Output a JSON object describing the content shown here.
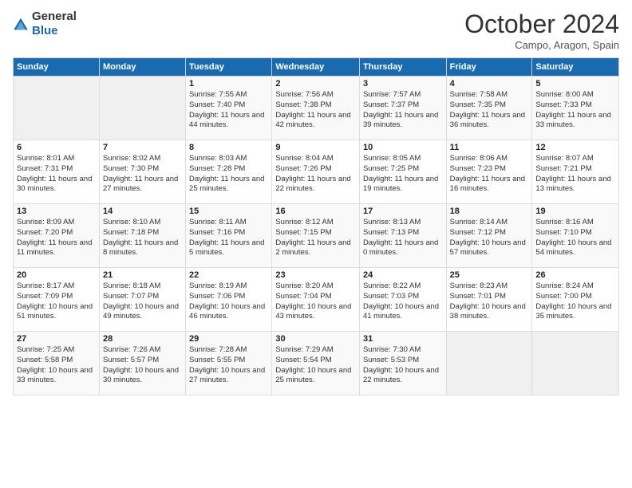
{
  "logo": {
    "general": "General",
    "blue": "Blue"
  },
  "header": {
    "month": "October 2024",
    "location": "Campo, Aragon, Spain"
  },
  "days_of_week": [
    "Sunday",
    "Monday",
    "Tuesday",
    "Wednesday",
    "Thursday",
    "Friday",
    "Saturday"
  ],
  "weeks": [
    [
      {
        "day": "",
        "info": ""
      },
      {
        "day": "",
        "info": ""
      },
      {
        "day": "1",
        "info": "Sunrise: 7:55 AM\nSunset: 7:40 PM\nDaylight: 11 hours and 44 minutes."
      },
      {
        "day": "2",
        "info": "Sunrise: 7:56 AM\nSunset: 7:38 PM\nDaylight: 11 hours and 42 minutes."
      },
      {
        "day": "3",
        "info": "Sunrise: 7:57 AM\nSunset: 7:37 PM\nDaylight: 11 hours and 39 minutes."
      },
      {
        "day": "4",
        "info": "Sunrise: 7:58 AM\nSunset: 7:35 PM\nDaylight: 11 hours and 36 minutes."
      },
      {
        "day": "5",
        "info": "Sunrise: 8:00 AM\nSunset: 7:33 PM\nDaylight: 11 hours and 33 minutes."
      }
    ],
    [
      {
        "day": "6",
        "info": "Sunrise: 8:01 AM\nSunset: 7:31 PM\nDaylight: 11 hours and 30 minutes."
      },
      {
        "day": "7",
        "info": "Sunrise: 8:02 AM\nSunset: 7:30 PM\nDaylight: 11 hours and 27 minutes."
      },
      {
        "day": "8",
        "info": "Sunrise: 8:03 AM\nSunset: 7:28 PM\nDaylight: 11 hours and 25 minutes."
      },
      {
        "day": "9",
        "info": "Sunrise: 8:04 AM\nSunset: 7:26 PM\nDaylight: 11 hours and 22 minutes."
      },
      {
        "day": "10",
        "info": "Sunrise: 8:05 AM\nSunset: 7:25 PM\nDaylight: 11 hours and 19 minutes."
      },
      {
        "day": "11",
        "info": "Sunrise: 8:06 AM\nSunset: 7:23 PM\nDaylight: 11 hours and 16 minutes."
      },
      {
        "day": "12",
        "info": "Sunrise: 8:07 AM\nSunset: 7:21 PM\nDaylight: 11 hours and 13 minutes."
      }
    ],
    [
      {
        "day": "13",
        "info": "Sunrise: 8:09 AM\nSunset: 7:20 PM\nDaylight: 11 hours and 11 minutes."
      },
      {
        "day": "14",
        "info": "Sunrise: 8:10 AM\nSunset: 7:18 PM\nDaylight: 11 hours and 8 minutes."
      },
      {
        "day": "15",
        "info": "Sunrise: 8:11 AM\nSunset: 7:16 PM\nDaylight: 11 hours and 5 minutes."
      },
      {
        "day": "16",
        "info": "Sunrise: 8:12 AM\nSunset: 7:15 PM\nDaylight: 11 hours and 2 minutes."
      },
      {
        "day": "17",
        "info": "Sunrise: 8:13 AM\nSunset: 7:13 PM\nDaylight: 11 hours and 0 minutes."
      },
      {
        "day": "18",
        "info": "Sunrise: 8:14 AM\nSunset: 7:12 PM\nDaylight: 10 hours and 57 minutes."
      },
      {
        "day": "19",
        "info": "Sunrise: 8:16 AM\nSunset: 7:10 PM\nDaylight: 10 hours and 54 minutes."
      }
    ],
    [
      {
        "day": "20",
        "info": "Sunrise: 8:17 AM\nSunset: 7:09 PM\nDaylight: 10 hours and 51 minutes."
      },
      {
        "day": "21",
        "info": "Sunrise: 8:18 AM\nSunset: 7:07 PM\nDaylight: 10 hours and 49 minutes."
      },
      {
        "day": "22",
        "info": "Sunrise: 8:19 AM\nSunset: 7:06 PM\nDaylight: 10 hours and 46 minutes."
      },
      {
        "day": "23",
        "info": "Sunrise: 8:20 AM\nSunset: 7:04 PM\nDaylight: 10 hours and 43 minutes."
      },
      {
        "day": "24",
        "info": "Sunrise: 8:22 AM\nSunset: 7:03 PM\nDaylight: 10 hours and 41 minutes."
      },
      {
        "day": "25",
        "info": "Sunrise: 8:23 AM\nSunset: 7:01 PM\nDaylight: 10 hours and 38 minutes."
      },
      {
        "day": "26",
        "info": "Sunrise: 8:24 AM\nSunset: 7:00 PM\nDaylight: 10 hours and 35 minutes."
      }
    ],
    [
      {
        "day": "27",
        "info": "Sunrise: 7:25 AM\nSunset: 5:58 PM\nDaylight: 10 hours and 33 minutes."
      },
      {
        "day": "28",
        "info": "Sunrise: 7:26 AM\nSunset: 5:57 PM\nDaylight: 10 hours and 30 minutes."
      },
      {
        "day": "29",
        "info": "Sunrise: 7:28 AM\nSunset: 5:55 PM\nDaylight: 10 hours and 27 minutes."
      },
      {
        "day": "30",
        "info": "Sunrise: 7:29 AM\nSunset: 5:54 PM\nDaylight: 10 hours and 25 minutes."
      },
      {
        "day": "31",
        "info": "Sunrise: 7:30 AM\nSunset: 5:53 PM\nDaylight: 10 hours and 22 minutes."
      },
      {
        "day": "",
        "info": ""
      },
      {
        "day": "",
        "info": ""
      }
    ]
  ]
}
